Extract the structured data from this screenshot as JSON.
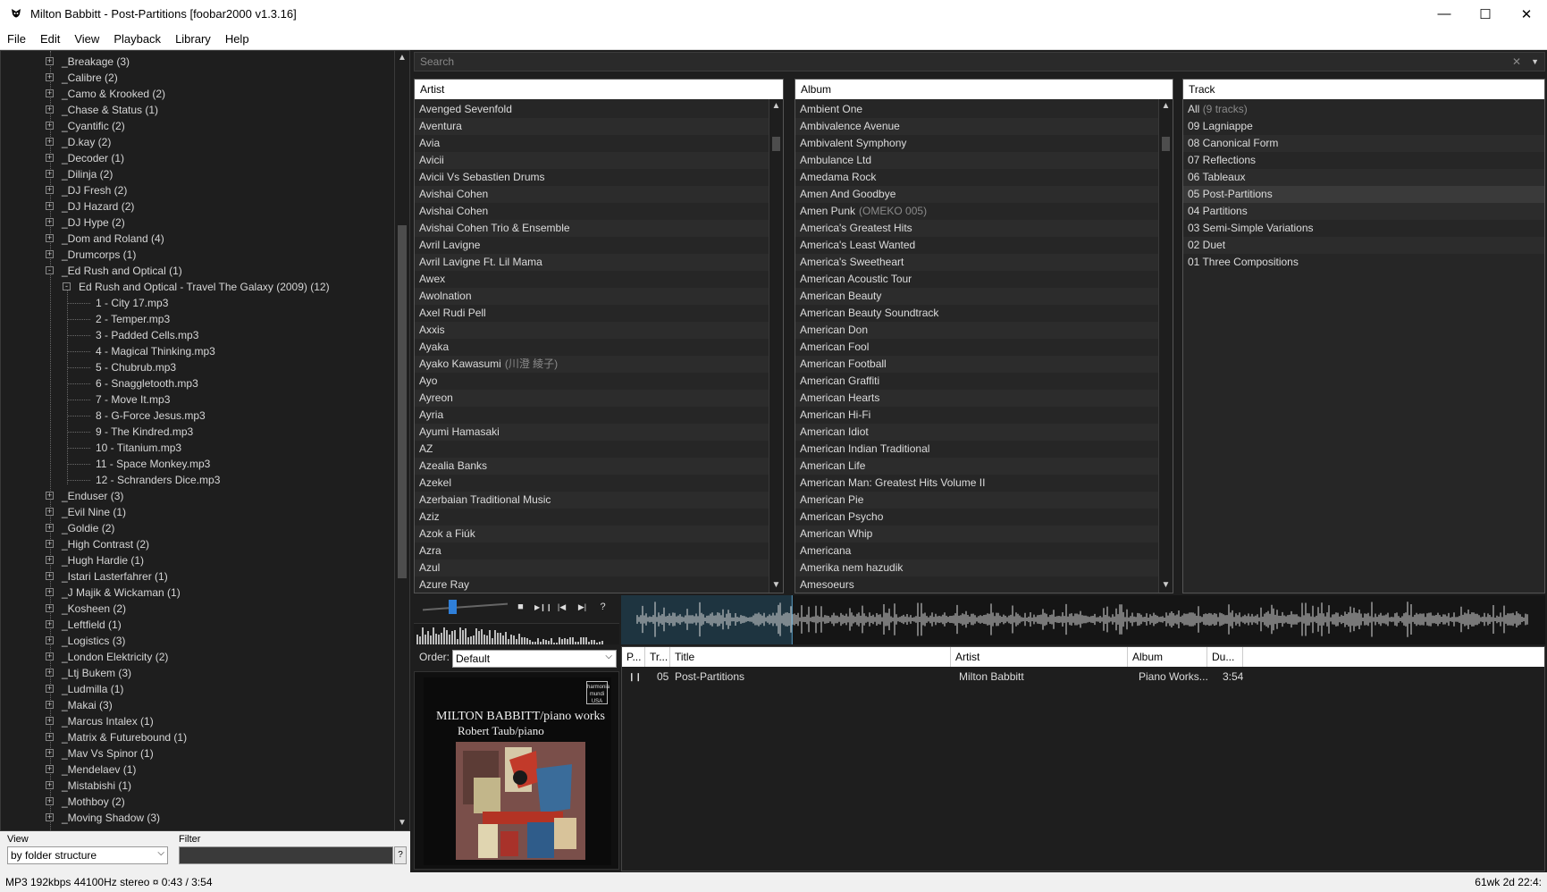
{
  "window": {
    "title": "Milton Babbitt - Post-Partitions    [foobar2000 v1.3.16]",
    "controls": {
      "minimize": "—",
      "maximize": "☐",
      "close": "✕"
    }
  },
  "menu": [
    "File",
    "Edit",
    "View",
    "Playback",
    "Library",
    "Help"
  ],
  "library_tree": {
    "items": [
      {
        "label": "_Breakage (3)",
        "level": 1,
        "expander": "+"
      },
      {
        "label": "_Calibre (2)",
        "level": 1,
        "expander": "+"
      },
      {
        "label": "_Camo & Krooked (2)",
        "level": 1,
        "expander": "+"
      },
      {
        "label": "_Chase & Status (1)",
        "level": 1,
        "expander": "+"
      },
      {
        "label": "_Cyantific (2)",
        "level": 1,
        "expander": "+"
      },
      {
        "label": "_D.kay (2)",
        "level": 1,
        "expander": "+"
      },
      {
        "label": "_Decoder (1)",
        "level": 1,
        "expander": "+"
      },
      {
        "label": "_Dilinja (2)",
        "level": 1,
        "expander": "+"
      },
      {
        "label": "_DJ Fresh (2)",
        "level": 1,
        "expander": "+"
      },
      {
        "label": "_DJ Hazard (2)",
        "level": 1,
        "expander": "+"
      },
      {
        "label": "_DJ Hype (2)",
        "level": 1,
        "expander": "+"
      },
      {
        "label": "_Dom and Roland (4)",
        "level": 1,
        "expander": "+"
      },
      {
        "label": "_Drumcorps (1)",
        "level": 1,
        "expander": "+"
      },
      {
        "label": "_Ed Rush and Optical (1)",
        "level": 1,
        "expander": "-"
      },
      {
        "label": "Ed Rush and Optical - Travel The Galaxy (2009) (12)",
        "level": 2,
        "expander": "-"
      },
      {
        "label": "1 - City 17.mp3",
        "level": 3,
        "expander": ""
      },
      {
        "label": "2 - Temper.mp3",
        "level": 3,
        "expander": ""
      },
      {
        "label": "3 - Padded Cells.mp3",
        "level": 3,
        "expander": ""
      },
      {
        "label": "4 - Magical Thinking.mp3",
        "level": 3,
        "expander": ""
      },
      {
        "label": "5 - Chubrub.mp3",
        "level": 3,
        "expander": ""
      },
      {
        "label": "6 - Snaggletooth.mp3",
        "level": 3,
        "expander": ""
      },
      {
        "label": "7 - Move It.mp3",
        "level": 3,
        "expander": ""
      },
      {
        "label": "8 - G-Force Jesus.mp3",
        "level": 3,
        "expander": ""
      },
      {
        "label": "9 - The Kindred.mp3",
        "level": 3,
        "expander": ""
      },
      {
        "label": "10 - Titanium.mp3",
        "level": 3,
        "expander": ""
      },
      {
        "label": "11 - Space Monkey.mp3",
        "level": 3,
        "expander": ""
      },
      {
        "label": "12 - Schranders Dice.mp3",
        "level": 3,
        "expander": ""
      },
      {
        "label": "_Enduser (3)",
        "level": 1,
        "expander": "+"
      },
      {
        "label": "_Evil Nine (1)",
        "level": 1,
        "expander": "+"
      },
      {
        "label": "_Goldie (2)",
        "level": 1,
        "expander": "+"
      },
      {
        "label": "_High Contrast (2)",
        "level": 1,
        "expander": "+"
      },
      {
        "label": "_Hugh Hardie (1)",
        "level": 1,
        "expander": "+"
      },
      {
        "label": "_Istari Lasterfahrer (1)",
        "level": 1,
        "expander": "+"
      },
      {
        "label": "_J Majik & Wickaman (1)",
        "level": 1,
        "expander": "+"
      },
      {
        "label": "_Kosheen (2)",
        "level": 1,
        "expander": "+"
      },
      {
        "label": "_Leftfield (1)",
        "level": 1,
        "expander": "+"
      },
      {
        "label": "_Logistics (3)",
        "level": 1,
        "expander": "+"
      },
      {
        "label": "_London Elektricity (2)",
        "level": 1,
        "expander": "+"
      },
      {
        "label": "_Ltj Bukem (3)",
        "level": 1,
        "expander": "+"
      },
      {
        "label": "_Ludmilla (1)",
        "level": 1,
        "expander": "+"
      },
      {
        "label": "_Makai (3)",
        "level": 1,
        "expander": "+"
      },
      {
        "label": "_Marcus Intalex (1)",
        "level": 1,
        "expander": "+"
      },
      {
        "label": "_Matrix & Futurebound (1)",
        "level": 1,
        "expander": "+"
      },
      {
        "label": "_Mav Vs Spinor (1)",
        "level": 1,
        "expander": "+"
      },
      {
        "label": "_Mendelaev (1)",
        "level": 1,
        "expander": "+"
      },
      {
        "label": "_Mistabishi (1)",
        "level": 1,
        "expander": "+"
      },
      {
        "label": "_Mothboy (2)",
        "level": 1,
        "expander": "+"
      },
      {
        "label": "_Moving Shadow (3)",
        "level": 1,
        "expander": "+"
      }
    ]
  },
  "view_filter": {
    "view_label": "View",
    "view_value": "by folder structure",
    "filter_label": "Filter",
    "filter_value": "",
    "help": "?"
  },
  "search": {
    "placeholder": "Search",
    "clear": "✕",
    "dropdown": "▼"
  },
  "artist_pane": {
    "header": "Artist",
    "items": [
      "Avenged Sevenfold",
      "Aventura",
      "Avia",
      "Avicii",
      "Avicii Vs Sebastien Drums",
      "Avishai Cohen",
      "Avishai Cohen",
      "Avishai Cohen Trio & Ensemble",
      "Avril Lavigne",
      "Avril Lavigne Ft. Lil Mama",
      "Awex",
      "Awolnation",
      "Axel Rudi Pell",
      "Axxis",
      "Ayaka",
      "Ayako Kawasumi",
      "Ayo",
      "Ayreon",
      "Ayria",
      "Ayumi Hamasaki",
      "AZ",
      "Azealia Banks",
      "Azekel",
      "Azerbaian Traditional Music",
      "Aziz",
      "Azok a Fiúk",
      "Azra",
      "Azul",
      "Azure Ray"
    ],
    "suffixes": {
      "15": "(川澄 綾子)"
    }
  },
  "album_pane": {
    "header": "Album",
    "items": [
      "Ambient One",
      "Ambivalence Avenue",
      "Ambivalent Symphony",
      "Ambulance Ltd",
      "Amedama Rock",
      "Amen And Goodbye",
      "Amen Punk",
      "America's Greatest Hits",
      "America's Least Wanted",
      "America's Sweetheart",
      "American Acoustic Tour",
      "American Beauty",
      "American Beauty Soundtrack",
      "American Don",
      "American Fool",
      "American Football",
      "American Graffiti",
      "American Hearts",
      "American Hi-Fi",
      "American Idiot",
      "American Indian Traditional",
      "American Life",
      "American Man: Greatest Hits Volume II",
      "American Pie",
      "American Psycho",
      "American Whip",
      "Americana",
      "Amerika nem hazudik",
      "Amesoeurs"
    ],
    "suffixes": {
      "6": "(OMEKO 005)"
    }
  },
  "track_pane": {
    "header": "Track",
    "all_label": "All",
    "all_count": "(9 tracks)",
    "items": [
      "09 Lagniappe",
      "08 Canonical Form",
      "07 Reflections",
      "06 Tableaux",
      "05 Post-Partitions",
      "04 Partitions",
      "03 Semi-Simple Variations",
      "02 Duet",
      "01 Three Compositions"
    ],
    "selected_index": 4
  },
  "transport": {
    "volume_level": 0.35,
    "buttons": [
      "■",
      "▶❙❙",
      "|◀",
      "▶|",
      "?"
    ]
  },
  "waveform": {
    "played_fraction": 0.185
  },
  "order": {
    "label": "Order:",
    "value": "Default"
  },
  "album_art": {
    "line1": "MILTON BABBITT/piano works",
    "line2": "Robert Taub/piano",
    "logo": "harmonia mundi USA"
  },
  "playlist": {
    "columns": [
      "P...",
      "Tr...",
      "Title",
      "Artist",
      "Album",
      "Du..."
    ],
    "rows": [
      {
        "playing": "❙❙",
        "track": "05",
        "title": "Post-Partitions",
        "artist": "Milton Babbitt",
        "album": "Piano Works...",
        "duration": "3:54"
      }
    ]
  },
  "status": {
    "left": "MP3 192kbps 44100Hz stereo   ¤  0:43 / 3:54",
    "right": "61wk 2d 22:4:"
  },
  "colors": {
    "accent": "#2f7fd9",
    "background": "#1e1e1e",
    "pane": "#262626"
  }
}
